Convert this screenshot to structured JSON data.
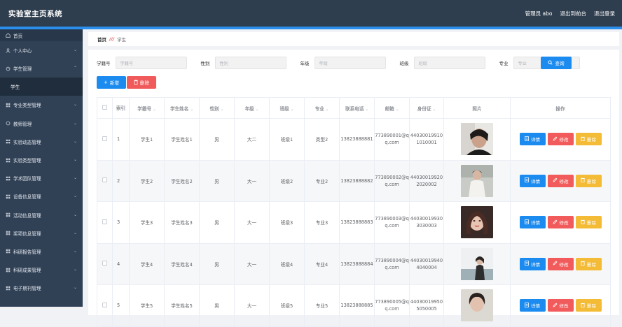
{
  "header": {
    "title": "实验室主页系统",
    "admin": "管理员 abo",
    "backend": "退出到前台",
    "logout": "退出登录"
  },
  "sidebar": {
    "items": [
      {
        "label": "首页",
        "icon": "home-icon"
      },
      {
        "label": "个人中心",
        "icon": "user-icon"
      },
      {
        "label": "学生管理",
        "icon": "settings-icon",
        "expanded": true,
        "children": [
          {
            "label": "学生"
          }
        ]
      },
      {
        "label": "专业类型管理",
        "icon": "grid-icon"
      },
      {
        "label": "教师管理",
        "icon": "circle-icon"
      },
      {
        "label": "实验动态管理",
        "icon": "grid-icon"
      },
      {
        "label": "实验类型管理",
        "icon": "grid-icon"
      },
      {
        "label": "学术团队管理",
        "icon": "grid-icon"
      },
      {
        "label": "设备信息管理",
        "icon": "grid-icon"
      },
      {
        "label": "活动信息管理",
        "icon": "grid-icon"
      },
      {
        "label": "奖项信息管理",
        "icon": "grid-icon"
      },
      {
        "label": "科研报告管理",
        "icon": "grid-icon"
      },
      {
        "label": "科研成果管理",
        "icon": "grid-icon"
      },
      {
        "label": "电子期刊管理",
        "icon": "grid-icon"
      }
    ]
  },
  "breadcrumb": {
    "home": "首页",
    "separator": "///",
    "current": "学生"
  },
  "search": {
    "fields": [
      {
        "label": "学籍号",
        "placeholder": "学籍号"
      },
      {
        "label": "性别",
        "placeholder": "性别"
      },
      {
        "label": "年级",
        "placeholder": "年级"
      },
      {
        "label": "班级",
        "placeholder": "班级"
      },
      {
        "label": "专业",
        "placeholder": "专业"
      }
    ],
    "query_label": "查询"
  },
  "toolbar": {
    "add_label": "新增",
    "delete_label": "删除"
  },
  "table": {
    "headers": {
      "index": "索引",
      "student_no": "学籍号",
      "name": "学生姓名",
      "gender": "性别",
      "grade": "年级",
      "class": "班级",
      "major": "专业",
      "phone": "联系电话",
      "email": "邮箱",
      "idcard": "身份证",
      "photo": "照片",
      "actions": "操作"
    },
    "rows": [
      {
        "index": "1",
        "student_no": "学生1",
        "name": "学生姓名1",
        "gender": "男",
        "grade": "大二",
        "class": "班级1",
        "major": "类型2",
        "phone": "13823888881",
        "email": "773890001@qq.com",
        "idcard": "440300199101010001"
      },
      {
        "index": "2",
        "student_no": "学生2",
        "name": "学生姓名2",
        "gender": "男",
        "grade": "大一",
        "class": "班级2",
        "major": "专业2",
        "phone": "13823888882",
        "email": "773890002@qq.com",
        "idcard": "440300199202020002"
      },
      {
        "index": "3",
        "student_no": "学生3",
        "name": "学生姓名3",
        "gender": "男",
        "grade": "大一",
        "class": "班级3",
        "major": "专业3",
        "phone": "13823888883",
        "email": "773890003@qq.com",
        "idcard": "440300199303030003"
      },
      {
        "index": "4",
        "student_no": "学生4",
        "name": "学生姓名4",
        "gender": "男",
        "grade": "大一",
        "class": "班级4",
        "major": "专业4",
        "phone": "13823888884",
        "email": "773890004@qq.com",
        "idcard": "440300199404040004"
      },
      {
        "index": "5",
        "student_no": "学生5",
        "name": "学生姓名5",
        "gender": "男",
        "grade": "大一",
        "class": "班级5",
        "major": "专业5",
        "phone": "13823888885",
        "email": "773890005@qq.com",
        "idcard": "440300199505050005"
      }
    ],
    "actions": {
      "detail": "详情",
      "edit": "修改",
      "delete": "删除"
    }
  },
  "colors": {
    "topbar": "#2f3e4f",
    "sidebar": "#304156",
    "primary": "#1c8bef",
    "danger": "#f25b5b",
    "warning": "#f3bb36"
  }
}
